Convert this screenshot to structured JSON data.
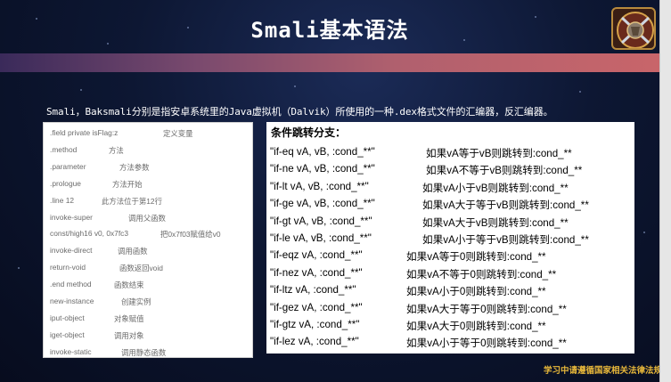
{
  "slide": {
    "title": "Smali基本语法",
    "intro": "Smali，Baksmali分别是指安卓系统里的Java虚拟机（Dalvik）所使用的一种.dex格式文件的汇编器，反汇编器。",
    "footer_note": "学习中请遵循国家相关法律法规",
    "colors": {
      "background": "#0d1733",
      "band_start": "#3a2a5a",
      "band_end": "#c8656a",
      "footer": "#e8b83a"
    }
  },
  "left_table": [
    {
      "code": ".field private isFlag:z",
      "desc": "定义变量"
    },
    {
      "code": ".method",
      "desc": "方法"
    },
    {
      "code": ".parameter",
      "desc": "方法参数"
    },
    {
      "code": ".prologue",
      "desc": "方法开始"
    },
    {
      "code": ".line 12",
      "desc": "此方法位于第12行"
    },
    {
      "code": "invoke-super",
      "desc": "调用父函数"
    },
    {
      "code": "const/high16  v0, 0x7fc3",
      "desc": "把0x7f03赋值给v0"
    },
    {
      "code": "invoke-direct",
      "desc": "调用函数"
    },
    {
      "code": "return-void",
      "desc": "函数返回void"
    },
    {
      "code": ".end method",
      "desc": "函数结束"
    },
    {
      "code": "new-instance",
      "desc": "创建实例"
    },
    {
      "code": "iput-object",
      "desc": "对象赋值"
    },
    {
      "code": "iget-object",
      "desc": "调用对象"
    },
    {
      "code": "invoke-static",
      "desc": "调用静态函数"
    }
  ],
  "right_table": {
    "title": "条件跳转分支：",
    "rows": [
      {
        "code": "\"if-eq vA, vB, :cond_**\"",
        "desc": "如果vA等于vB则跳转到:cond_**"
      },
      {
        "code": "\"if-ne vA, vB, :cond_**\"",
        "desc": "如果vA不等于vB则跳转到:cond_**"
      },
      {
        "code": "\"if-lt vA, vB, :cond_**\"",
        "desc": "如果vA小于vB则跳转到:cond_**"
      },
      {
        "code": "\"if-ge vA, vB, :cond_**\"",
        "desc": "如果vA大于等于vB则跳转到:cond_**"
      },
      {
        "code": "\"if-gt vA, vB, :cond_**\"",
        "desc": "如果vA大于vB则跳转到:cond_**"
      },
      {
        "code": "\"if-le vA, vB, :cond_**\"",
        "desc": "如果vA小于等于vB则跳转到:cond_**"
      },
      {
        "code": "\"if-eqz vA, :cond_**\"",
        "desc": "如果vA等于0则跳转到:cond_**"
      },
      {
        "code": "\"if-nez vA, :cond_**\"",
        "desc": "如果vA不等于0则跳转到:cond_**"
      },
      {
        "code": "\"if-ltz vA, :cond_**\"",
        "desc": "如果vA小于0则跳转到:cond_**"
      },
      {
        "code": "\"if-gez vA, :cond_**\"",
        "desc": "如果vA大于等于0则跳转到:cond_**"
      },
      {
        "code": "\"if-gtz vA, :cond_**\"",
        "desc": "如果vA大于0则跳转到:cond_**"
      },
      {
        "code": "\"if-lez vA, :cond_**\"",
        "desc": "如果vA小于等于0则跳转到:cond_**"
      }
    ]
  },
  "emblem": {
    "icon": "knight-shield-icon"
  }
}
